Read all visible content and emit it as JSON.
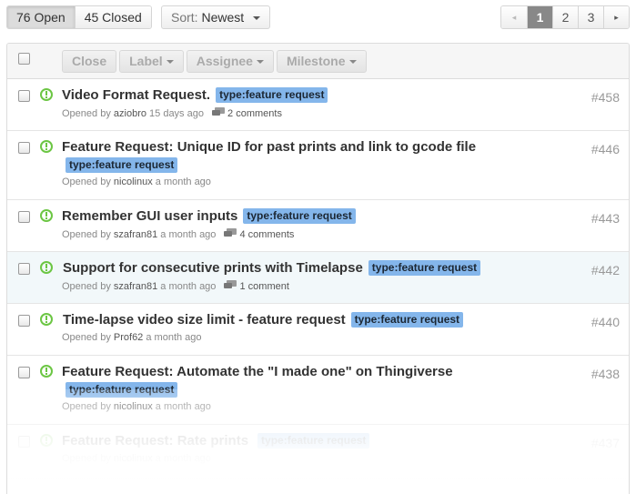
{
  "filters": {
    "open_label": "76 Open",
    "closed_label": "45 Closed",
    "sort_prefix": "Sort:",
    "sort_value": "Newest"
  },
  "pagination": {
    "prev_icon": "◂",
    "pages": [
      "1",
      "2",
      "3"
    ],
    "current": "1",
    "next_icon": "▸"
  },
  "bulk_actions": {
    "close": "Close",
    "label": "Label",
    "assignee": "Assignee",
    "milestone": "Milestone"
  },
  "colors": {
    "label_bg": "#84b6eb",
    "open_icon": "#6cc644"
  },
  "issues": [
    {
      "title": "Video Format Request.",
      "label": "type:feature request",
      "opened_by_prefix": "Opened by",
      "user": "aziobro",
      "ago": "15 days ago",
      "comments": "2 comments",
      "number": "#458"
    },
    {
      "title": "Feature Request: Unique ID for past prints and link to gcode file",
      "label": "type:feature request",
      "opened_by_prefix": "Opened by",
      "user": "nicolinux",
      "ago": "a month ago",
      "comments": "",
      "number": "#446"
    },
    {
      "title": "Remember GUI user inputs",
      "label": "type:feature request",
      "opened_by_prefix": "Opened by",
      "user": "szafran81",
      "ago": "a month ago",
      "comments": "4 comments",
      "number": "#443"
    },
    {
      "title": "Support for consecutive prints with Timelapse",
      "label": "type:feature request",
      "opened_by_prefix": "Opened by",
      "user": "szafran81",
      "ago": "a month ago",
      "comments": "1 comment",
      "number": "#442"
    },
    {
      "title": "Time-lapse video size limit - feature request",
      "label": "type:feature request",
      "opened_by_prefix": "Opened by",
      "user": "Prof62",
      "ago": "a month ago",
      "comments": "",
      "number": "#440"
    },
    {
      "title": "Feature Request: Automate the \"I made one\" on Thingiverse",
      "label": "type:feature request",
      "opened_by_prefix": "Opened by",
      "user": "nicolinux",
      "ago": "a month ago",
      "comments": "",
      "number": "#438"
    },
    {
      "title": "Feature Request: Rate prints",
      "label": "type:feature request",
      "opened_by_prefix": "Opened by",
      "user": "nicolinux",
      "ago": "a month ago",
      "comments": "",
      "number": "#437"
    }
  ]
}
